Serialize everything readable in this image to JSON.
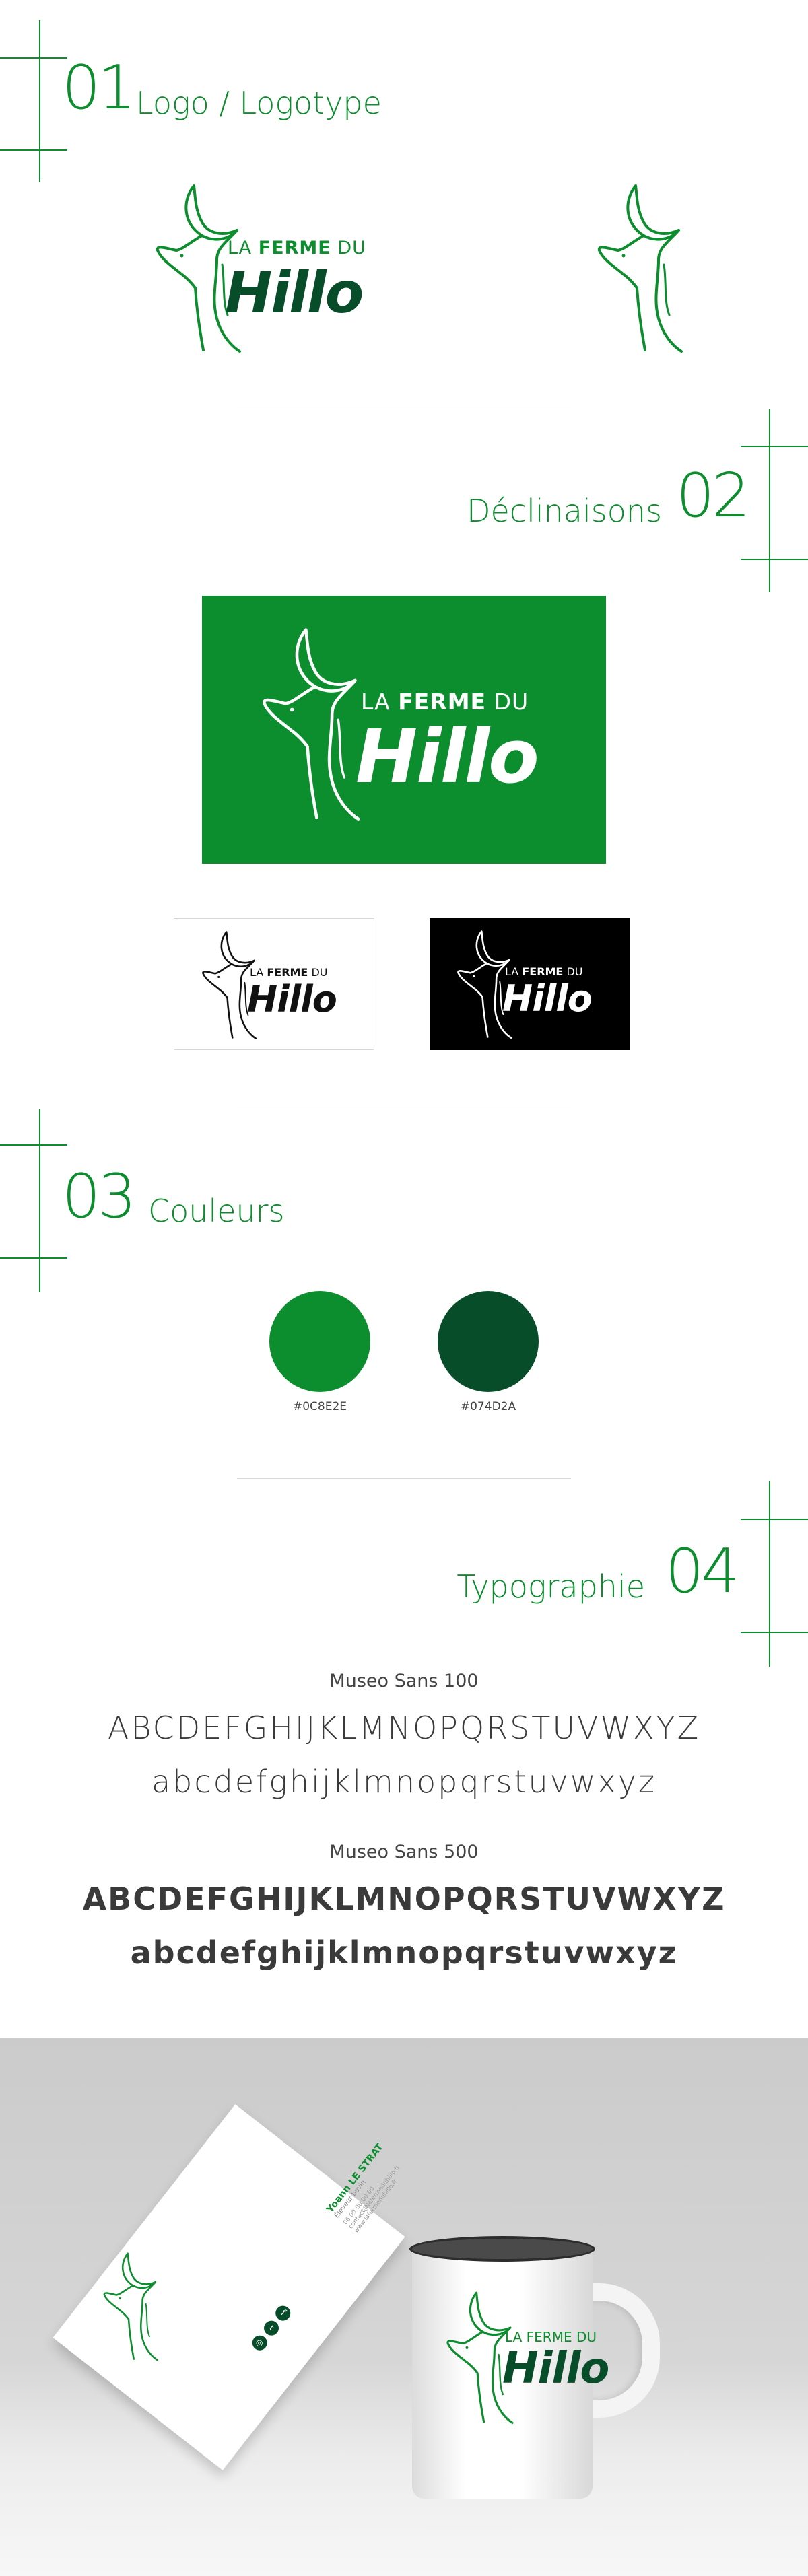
{
  "sections": {
    "s1": {
      "number": "01",
      "label": "Logo / Logotype"
    },
    "s2": {
      "number": "02",
      "label": "Déclinaisons"
    },
    "s3": {
      "number": "03",
      "label": "Couleurs"
    },
    "s4": {
      "number": "04",
      "label": "Typographie"
    }
  },
  "logo": {
    "line1_a": "LA",
    "line1_b": "FERME",
    "line1_c": "DU",
    "wordmark": "Hillo"
  },
  "colors": [
    {
      "hex": "#0C8E2E",
      "label": "#0C8E2E"
    },
    {
      "hex": "#074D2A",
      "label": "#074D2A"
    }
  ],
  "typography": {
    "font1": {
      "name": "Museo Sans 100",
      "upper": "ABCDEFGHIJKLMNOPQRSTUVWXYZ",
      "lower": "abcdefghijklmnopqrstuvwxyz"
    },
    "font2": {
      "name": "Museo Sans 500",
      "upper": "ABCDEFGHIJKLMNOPQRSTUVWXYZ",
      "lower": "abcdefghijklmnopqrstuvwxyz"
    }
  },
  "mockup": {
    "card_name": "Yoann LE STRAT",
    "card_role": "Éleveur bovin",
    "card_phone": "06 00 00 00 00",
    "card_email": "contact@lafermeduhillo.fr",
    "card_web": "www.lafermeduhillo.fr"
  },
  "palette": {
    "brand_green": "#0C8E2E",
    "dark_green": "#074D2A"
  }
}
